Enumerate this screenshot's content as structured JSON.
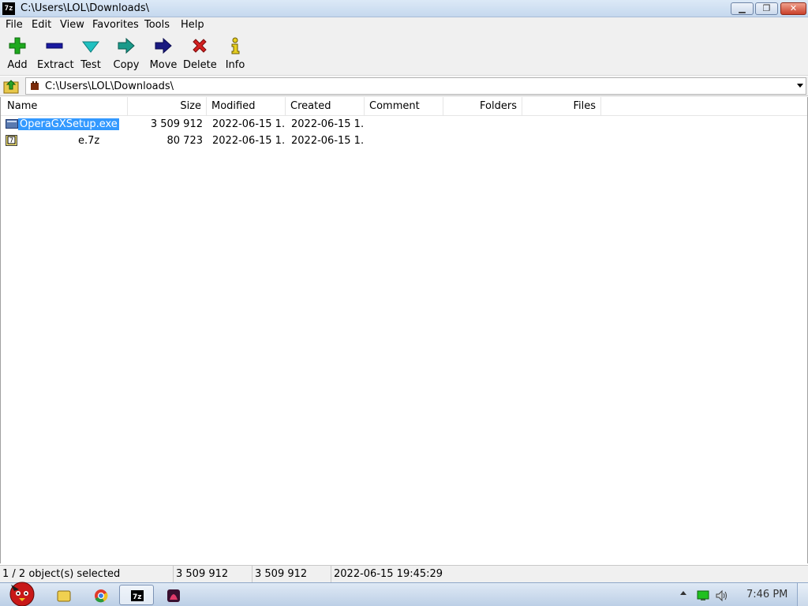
{
  "window": {
    "app_icon": "7z",
    "title": "C:\\Users\\LOL\\Downloads\\",
    "min_icon": "minimize-icon",
    "max_icon": "maximize-icon",
    "close_icon": "close-icon",
    "min_glyph": "▁",
    "max_glyph": "❐",
    "close_glyph": "✕"
  },
  "menu": [
    "File",
    "Edit",
    "View",
    "Favorites",
    "Tools",
    "Help"
  ],
  "toolbar": {
    "add": "Add",
    "extract": "Extract",
    "test": "Test",
    "copy": "Copy",
    "move": "Move",
    "delete": "Delete",
    "info": "Info"
  },
  "address": {
    "path": "C:\\Users\\LOL\\Downloads\\"
  },
  "columns": {
    "name": "Name",
    "size": "Size",
    "modified": "Modified",
    "created": "Created",
    "comment": "Comment",
    "folders": "Folders",
    "files": "Files"
  },
  "files": [
    {
      "name": "OperaGXSetup.exe",
      "size": "3 509 912",
      "modified": "2022-06-15 1...",
      "created": "2022-06-15 1...",
      "selected": true,
      "icon": "exe-file-icon"
    },
    {
      "name": "e.7z",
      "size": "80 723",
      "modified": "2022-06-15 1...",
      "created": "2022-06-15 1...",
      "selected": false,
      "icon": "7z-archive-icon"
    }
  ],
  "status": {
    "selection": "1 / 2 object(s) selected",
    "size": "3 509 912",
    "packed": "3 509 912",
    "date": "2022-06-15 19:45:29"
  },
  "taskbar": {
    "clock": "7:46 PM",
    "icons": [
      "start-orb-icon",
      "explorer-icon",
      "chrome-icon",
      "7zip-icon",
      "app-icon"
    ]
  },
  "colors": {
    "selection": "#3399ff",
    "add_green": "#1ea91e",
    "extract_blue": "#1a1aa0",
    "test_cyan": "#20c0c0",
    "delete_red": "#d42020",
    "info_yellow": "#e8d020"
  }
}
